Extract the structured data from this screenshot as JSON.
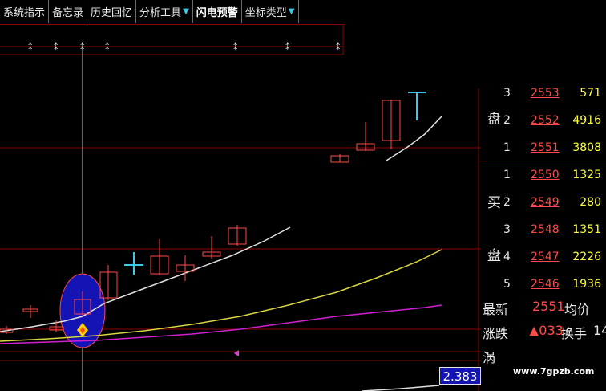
{
  "toolbar": {
    "items": [
      {
        "label": "系统指示",
        "dropdown": false
      },
      {
        "label": "备忘录",
        "dropdown": false
      },
      {
        "label": "历史回忆",
        "dropdown": false
      },
      {
        "label": "分析工具",
        "dropdown": true
      },
      {
        "label": "闪电预警",
        "dropdown": false
      },
      {
        "label": "坐标类型",
        "dropdown": true
      }
    ]
  },
  "order_book": {
    "sell_label_chars": [
      "盘"
    ],
    "sell": [
      {
        "level": "3",
        "price": "2553",
        "volume": "571"
      },
      {
        "level": "2",
        "price": "2552",
        "volume": "4916"
      },
      {
        "level": "1",
        "price": "2551",
        "volume": "3808"
      }
    ],
    "buy_label_chars": [
      "买",
      "盘"
    ],
    "buy": [
      {
        "level": "1",
        "price": "2550",
        "volume": "1325"
      },
      {
        "level": "2",
        "price": "2549",
        "volume": "280"
      },
      {
        "level": "3",
        "price": "2548",
        "volume": "1351"
      },
      {
        "level": "4",
        "price": "2547",
        "volume": "2226"
      },
      {
        "level": "5",
        "price": "2546",
        "volume": "1936"
      }
    ]
  },
  "stats": {
    "latest_label": "最新",
    "latest_value": "2551",
    "avg_label": "均价",
    "change_label": "涨跌",
    "change_value": "▲033",
    "turnover_label": "换手",
    "turnover_value": "14",
    "extra_label": "涡"
  },
  "price_tag": "2.383",
  "watermark": "www.7gpzb.com",
  "colors": {
    "up_candle": "#ff4a4a",
    "doji": "#3ec8e8",
    "ma_white": "#e0e0e0",
    "ma_yellow": "#d8d840",
    "ma_magenta": "#d020d0",
    "grid": "#8a0000",
    "highlight_ellipse": "#1414b4"
  }
}
